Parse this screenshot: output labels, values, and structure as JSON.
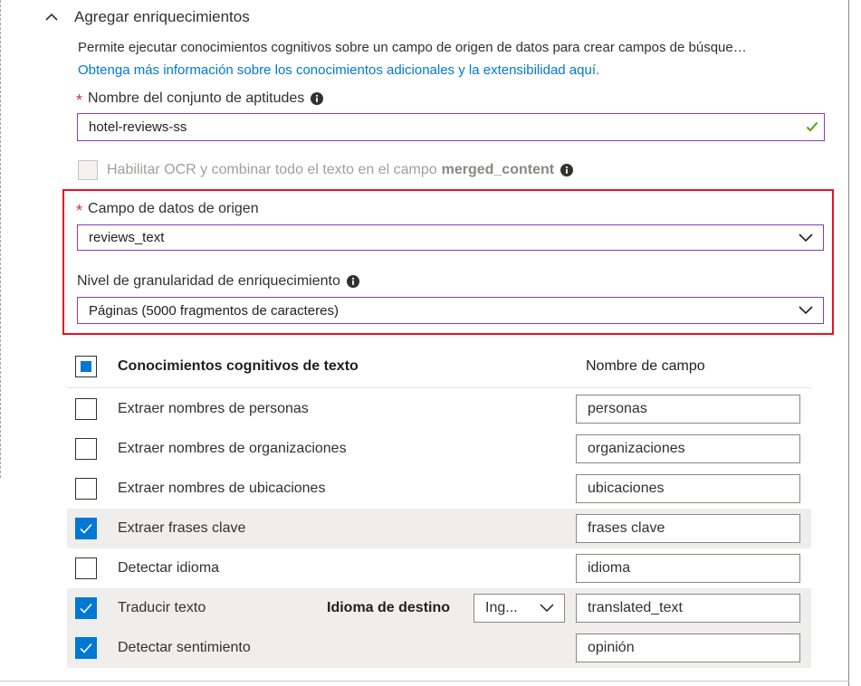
{
  "section": {
    "title": "Agregar enriquecimientos",
    "description": "Permite ejecutar conocimientos cognitivos sobre un campo de origen de datos para crear campos de búsque…",
    "learn_more_link": "Obtenga más información sobre los conocimientos adicionales y la extensibilidad aquí."
  },
  "skillset": {
    "required_mark": "*",
    "label": "Nombre del conjunto de aptitudes",
    "value": "hotel-reviews-ss"
  },
  "ocr": {
    "label": "Habilitar OCR y combinar todo el texto en el campo",
    "field_name": "merged_content",
    "checked": false,
    "disabled": true
  },
  "source_field": {
    "required_mark": "*",
    "label": "Campo de datos de origen",
    "selected": "reviews_text"
  },
  "granularity": {
    "label": "Nivel de granularidad de enriquecimiento",
    "selected": "Páginas (5000 fragmentos de caracteres)"
  },
  "skills_table": {
    "header_skill": "Conocimientos cognitivos de texto",
    "header_field": "Nombre de campo",
    "select_all_state": "partial",
    "rows": [
      {
        "label": "Extraer nombres de personas",
        "field": "personas",
        "checked": false
      },
      {
        "label": "Extraer nombres de organizaciones",
        "field": "organizaciones",
        "checked": false
      },
      {
        "label": "Extraer nombres de ubicaciones",
        "field": "ubicaciones",
        "checked": false
      },
      {
        "label": "Extraer frases clave",
        "field": "frases clave",
        "checked": true
      },
      {
        "label": "Detectar idioma",
        "field": "idioma",
        "checked": false
      },
      {
        "label": "Traducir texto",
        "field": "translated_text",
        "checked": true
      },
      {
        "label": "Detectar sentimiento",
        "field": "opinión",
        "checked": true
      }
    ],
    "target_language": {
      "label": "Idioma de destino",
      "selected": "Ing..."
    }
  },
  "colors": {
    "accent": "#0078d4",
    "required": "#d13438",
    "highlight_box": "#e81123",
    "valid": "#57a300"
  },
  "icons": {
    "collapse": "chevron-up-icon",
    "info": "info-icon",
    "valid": "checkmark-icon",
    "dropdown": "chevron-down-icon"
  }
}
